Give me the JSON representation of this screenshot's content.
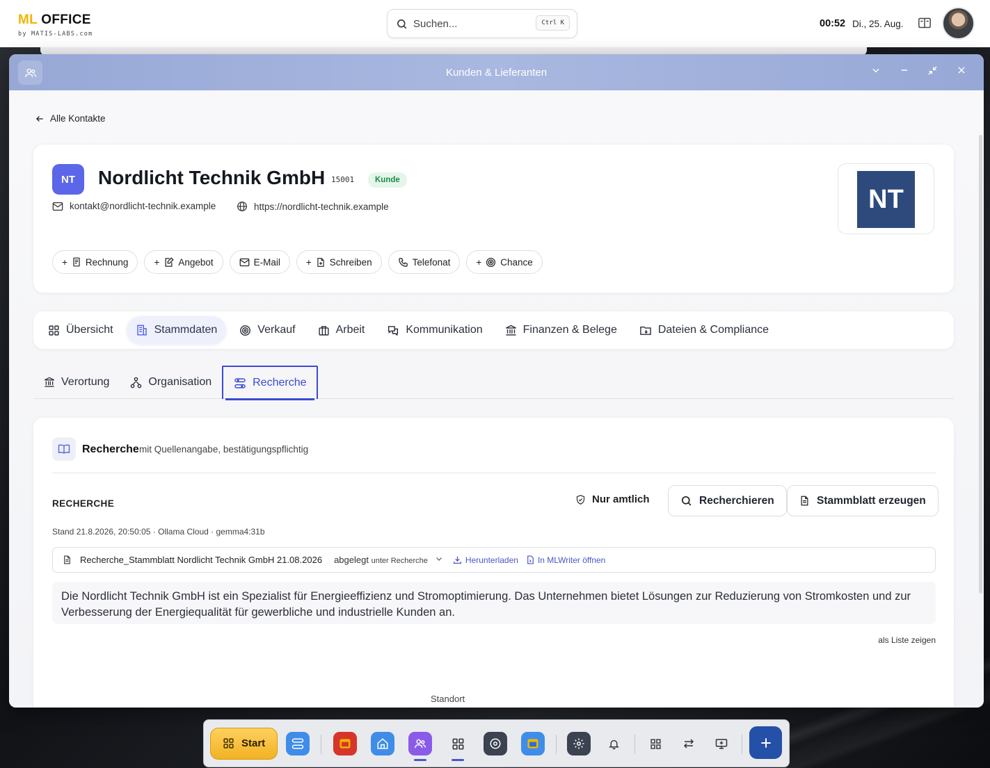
{
  "topbar": {
    "logo_main": "ML OFFICE",
    "logo_accent": "ML",
    "logo_rest": " OFFICE",
    "logo_sub": "by MATIS-LABS.com",
    "search_placeholder": "Suchen...",
    "search_shortcut": "Ctrl K",
    "time": "00:52",
    "date": "Di., 25. Aug."
  },
  "window": {
    "title": "Kunden & Lieferanten"
  },
  "nav": {
    "back_label": "Alle Kontakte"
  },
  "contact": {
    "initials": "NT",
    "name": "Nordlicht Technik GmbH",
    "number": "15001",
    "status": "Kunde",
    "email": "kontakt@nordlicht-technik.example",
    "website": "https://nordlicht-technik.example",
    "logo_initials": "NT"
  },
  "actions": [
    "Rechnung",
    "Angebot",
    "E-Mail",
    "Schreiben",
    "Telefonat",
    "Chance"
  ],
  "tabs": [
    {
      "label": "Übersicht",
      "active": false
    },
    {
      "label": "Stammdaten",
      "active": true
    },
    {
      "label": "Verkauf",
      "active": false
    },
    {
      "label": "Arbeit",
      "active": false
    },
    {
      "label": "Kommunikation",
      "active": false
    },
    {
      "label": "Finanzen & Belege",
      "active": false
    },
    {
      "label": "Dateien & Compliance",
      "active": false
    }
  ],
  "subtabs": [
    {
      "label": "Verortung",
      "active": false
    },
    {
      "label": "Organisation",
      "active": false
    },
    {
      "label": "Recherche",
      "active": true
    }
  ],
  "research": {
    "section_title": "Recherche",
    "section_subtitle": "mit Quellenangabe, bestätigungspflichtig",
    "label": "RECHERCHE",
    "official_only": "Nur amtlich",
    "search_button": "Recherchieren",
    "sheet_button": "Stammblatt erzeugen",
    "status_line": "Stand 21.8.2026, 20:50:05 · Ollama Cloud · gemma4:31b",
    "file_name": "Recherche_Stammblatt Nordlicht Technik GmbH 21.08.2026",
    "filed_label": "abgelegt",
    "filed_under": "unter Recherche",
    "download": "Herunterladen",
    "open_writer": "In MLWriter öffnen",
    "summary": "Die Nordlicht Technik GmbH ist ein Spezialist für Energieeffizienz und Stromoptimierung. Das Unternehmen bietet Lösungen zur Reduzierung von Stromkosten und zur Verbesserung der Energiequalität für gewerbliche und industrielle Kunden an.",
    "list_toggle": "als Liste zeigen",
    "next_section": "Standort"
  },
  "dock": {
    "start_label": "Start"
  },
  "colors": {
    "accent": "#3b4bd0",
    "titlebar": "#a3b3dd",
    "badge": "#5b67e8",
    "logo_bg": "#2e4a7d",
    "status_bg": "#e4f6ea",
    "status_fg": "#1f8a4a",
    "dock_start": "#f2b222",
    "dock_plus": "#2550a8"
  }
}
